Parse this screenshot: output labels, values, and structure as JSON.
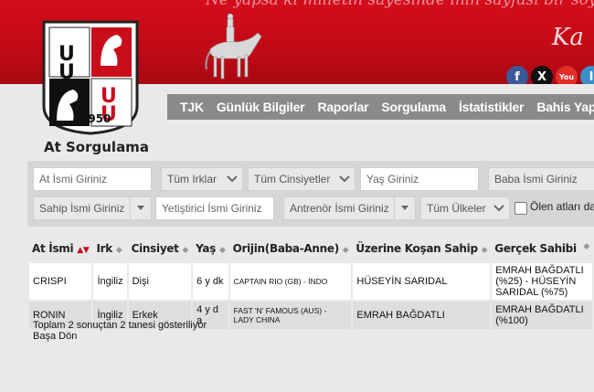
{
  "banner": {
    "script_text": "Ne yapsa ki milletin sayesinde inin sayfasi bir soylu",
    "signature": "Ka"
  },
  "social": [
    {
      "icon": "facebook-icon",
      "glyph": "f",
      "color": "#3b5998"
    },
    {
      "icon": "x-icon",
      "glyph": "X",
      "color": "#111111"
    },
    {
      "icon": "youtube-icon",
      "glyph": "You",
      "color": "#e52d27"
    },
    {
      "icon": "instagram-icon",
      "glyph": "I",
      "color": "#3a8fc8"
    }
  ],
  "logo": {
    "year": "1950"
  },
  "page_title": "At Sorgulama",
  "nav": [
    "TJK",
    "Günlük Bilgiler",
    "Raporlar",
    "Sorgulama",
    "İstatistikler",
    "Bahis Yap"
  ],
  "filters": {
    "horse_name": "At İsmi Giriniz",
    "breed": "Tüm Irklar",
    "gender": "Tüm Cinsiyetler",
    "age": "Yaş Giriniz",
    "sire": "Baba İsmi Giriniz",
    "owner": "Sahip İsmi Giriniz",
    "breeder": "Yetiştirici İsmi Giriniz",
    "trainer": "Antrenör İsmi Giriniz",
    "country": "Tüm Ülkeler",
    "dead_label": "Ölen atları da"
  },
  "table": {
    "headers": [
      "At İsmi",
      "Irk",
      "Cinsiyet",
      "Yaş",
      "Orijin(Baba-Anne)",
      "Üzerine Koşan Sahip",
      "Gerçek Sahibi"
    ],
    "rows": [
      [
        "CRISPI",
        "İngiliz",
        "Dişi",
        "6 y dk",
        "CAPTAIN RIO (GB) - İNDO",
        "HÜSEYİN SARIDAL",
        "EMRAH BAĞDATLI (%25) - HÜSEYİN SARIDAL (%75)"
      ],
      [
        "RONIN",
        "İngiliz",
        "Erkek",
        "4 y d a",
        "FAST 'N' FAMOUS (AUS) - LADY CHINA",
        "EMRAH BAĞDATLI",
        "EMRAH BAĞDATLI (%100)"
      ]
    ]
  },
  "summary": "Toplam 2 sonuçtan 2 tanesi gösteriliyor",
  "back_link": "Başa Dön"
}
